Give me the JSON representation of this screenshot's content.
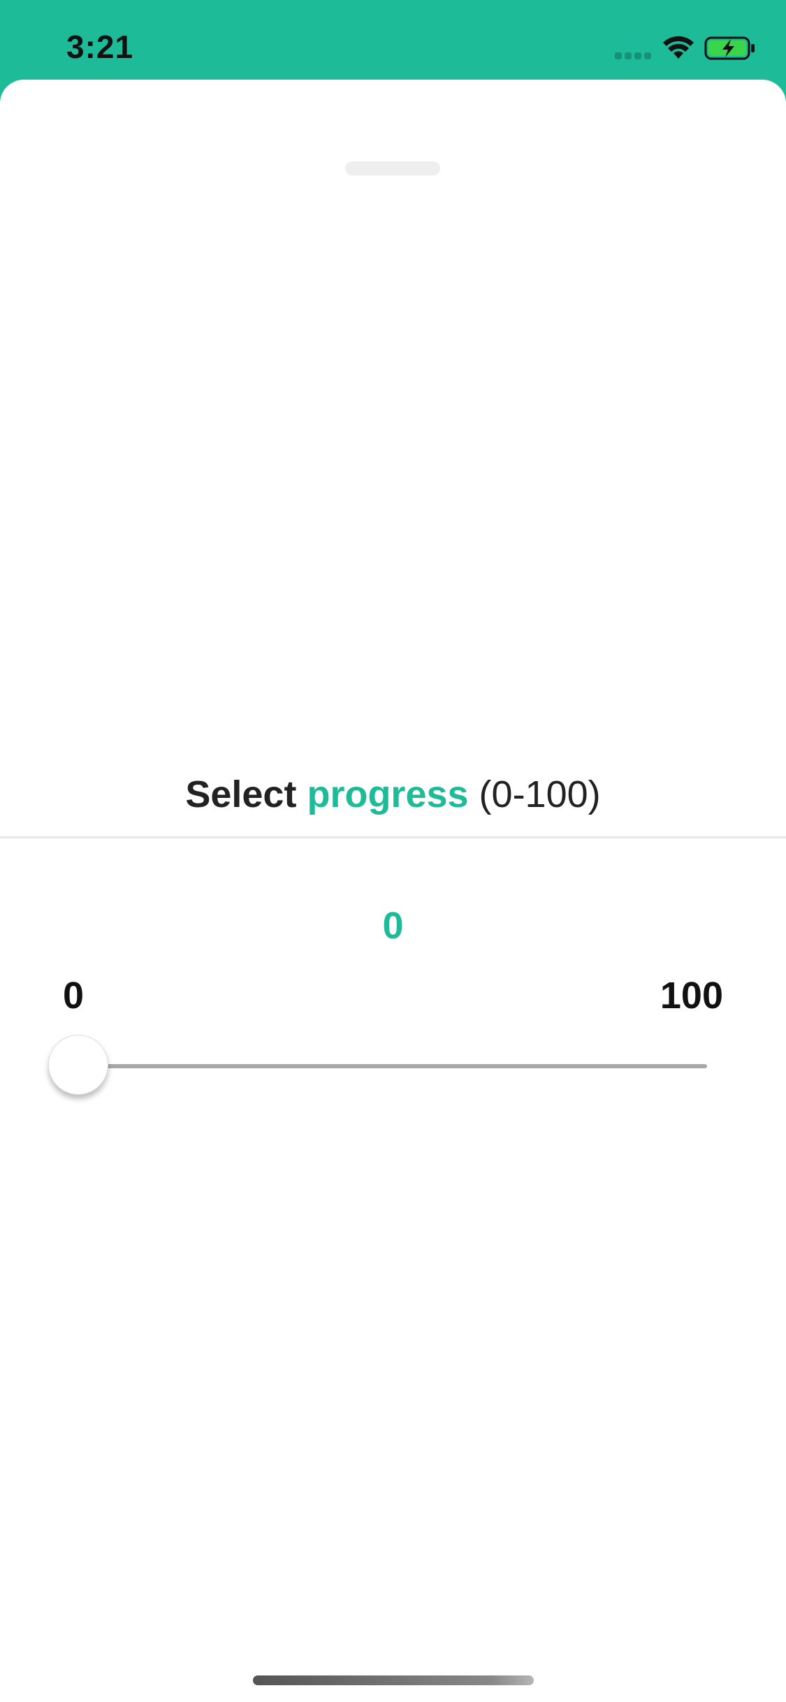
{
  "status_bar": {
    "time": "3:21",
    "icons": [
      "signal-icon",
      "wifi-icon",
      "battery-charging-icon"
    ]
  },
  "colors": {
    "accent": "#1ebb98",
    "text": "#222222"
  },
  "picker": {
    "title_prefix": "Select ",
    "title_highlight": "progress",
    "title_suffix": " (0-100)",
    "current_value": "0",
    "min_label": "0",
    "max_label": "100",
    "slider": {
      "min": 0,
      "max": 100,
      "value": 0
    }
  }
}
